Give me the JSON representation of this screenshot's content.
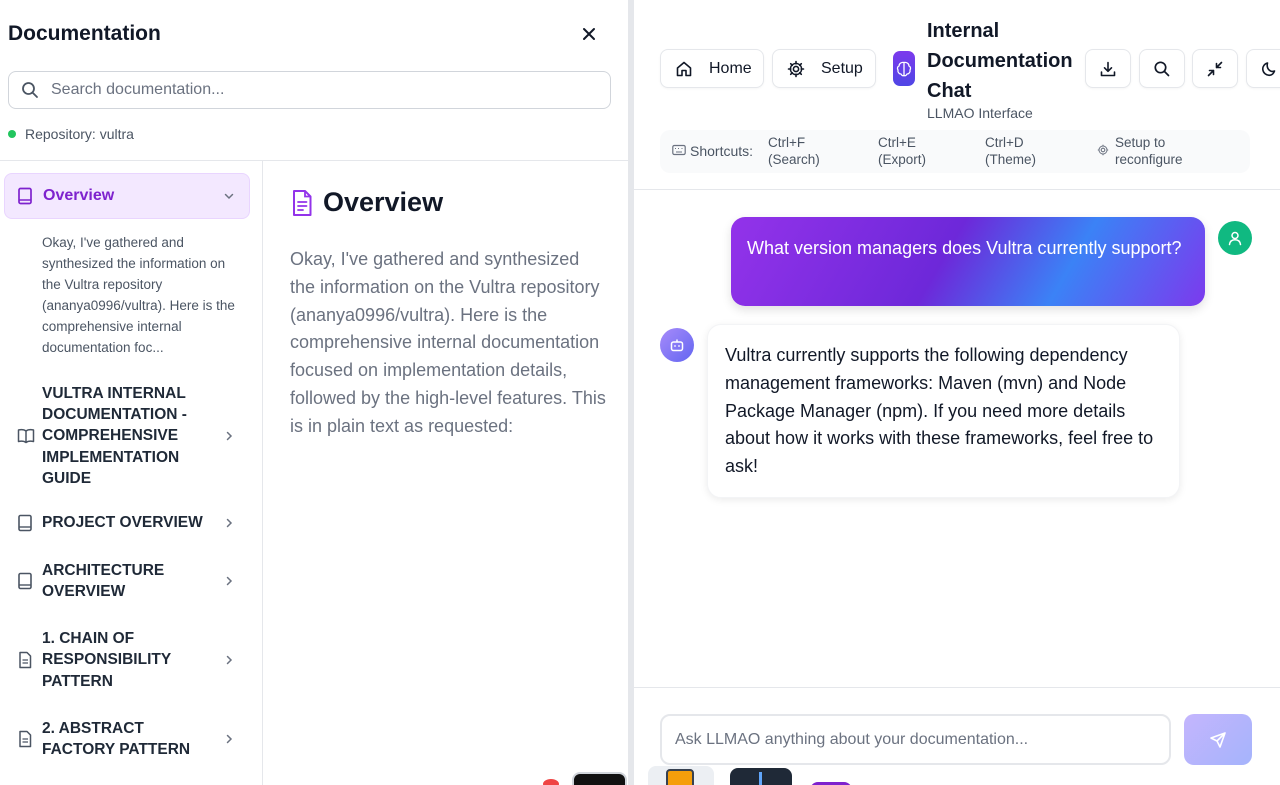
{
  "docs": {
    "title": "Documentation",
    "close_icon": "close-icon",
    "search": {
      "placeholder": "Search documentation..."
    },
    "repository": "Repository: vultra",
    "repo_status_color": "#22c55e",
    "nav": {
      "active": {
        "label": "Overview",
        "excerpt": "Okay, I've gathered and synthesized the information on the Vultra repository (ananya0996/vultra). Here is the comprehensive internal documentation foc..."
      },
      "items": [
        {
          "label": "VULTRA INTERNAL DOCUMENTATION - COMPREHENSIVE IMPLEMENTATION GUIDE",
          "icon": "book-open-icon"
        },
        {
          "label": "PROJECT OVERVIEW",
          "icon": "book-icon"
        },
        {
          "label": "ARCHITECTURE OVERVIEW",
          "icon": "book-icon"
        },
        {
          "label": "1. CHAIN OF RESPONSIBILITY PATTERN",
          "icon": "file-text-icon"
        },
        {
          "label": "2. ABSTRACT FACTORY PATTERN",
          "icon": "file-text-icon"
        }
      ]
    },
    "content": {
      "heading": "Overview",
      "body": "Okay, I've gathered and synthesized the information on the Vultra repository (ananya0996/vultra). Here is the comprehensive internal documentation focused on implementation details, followed by the high-level features. This is in plain text as requested:"
    }
  },
  "chat": {
    "header": {
      "home_label": "Home",
      "setup_label": "Setup",
      "title": "Internal Documentation Chat",
      "subtitle": "LLMAO Interface",
      "icons": [
        "download-icon",
        "search-icon",
        "minimize-icon",
        "moon-icon"
      ]
    },
    "shortcuts": {
      "label": "Shortcuts:",
      "search": "Ctrl+F (Search)",
      "export": "Ctrl+E (Export)",
      "theme": "Ctrl+D (Theme)",
      "reconfigure": "Setup to reconfigure"
    },
    "messages": [
      {
        "role": "user",
        "text": "What version managers does Vultra currently support?"
      },
      {
        "role": "assistant",
        "text": "Vultra currently supports the following dependency management frameworks: Maven (mvn) and Node Package Manager (npm). If you need more details about how it works with these frameworks, feel free to ask!"
      }
    ],
    "input": {
      "placeholder": "Ask LLMAO anything about your documentation..."
    },
    "colors": {
      "accent": "#7c3aed",
      "user_avatar": "#10b981",
      "active_nav_text": "#7e22ce"
    }
  }
}
